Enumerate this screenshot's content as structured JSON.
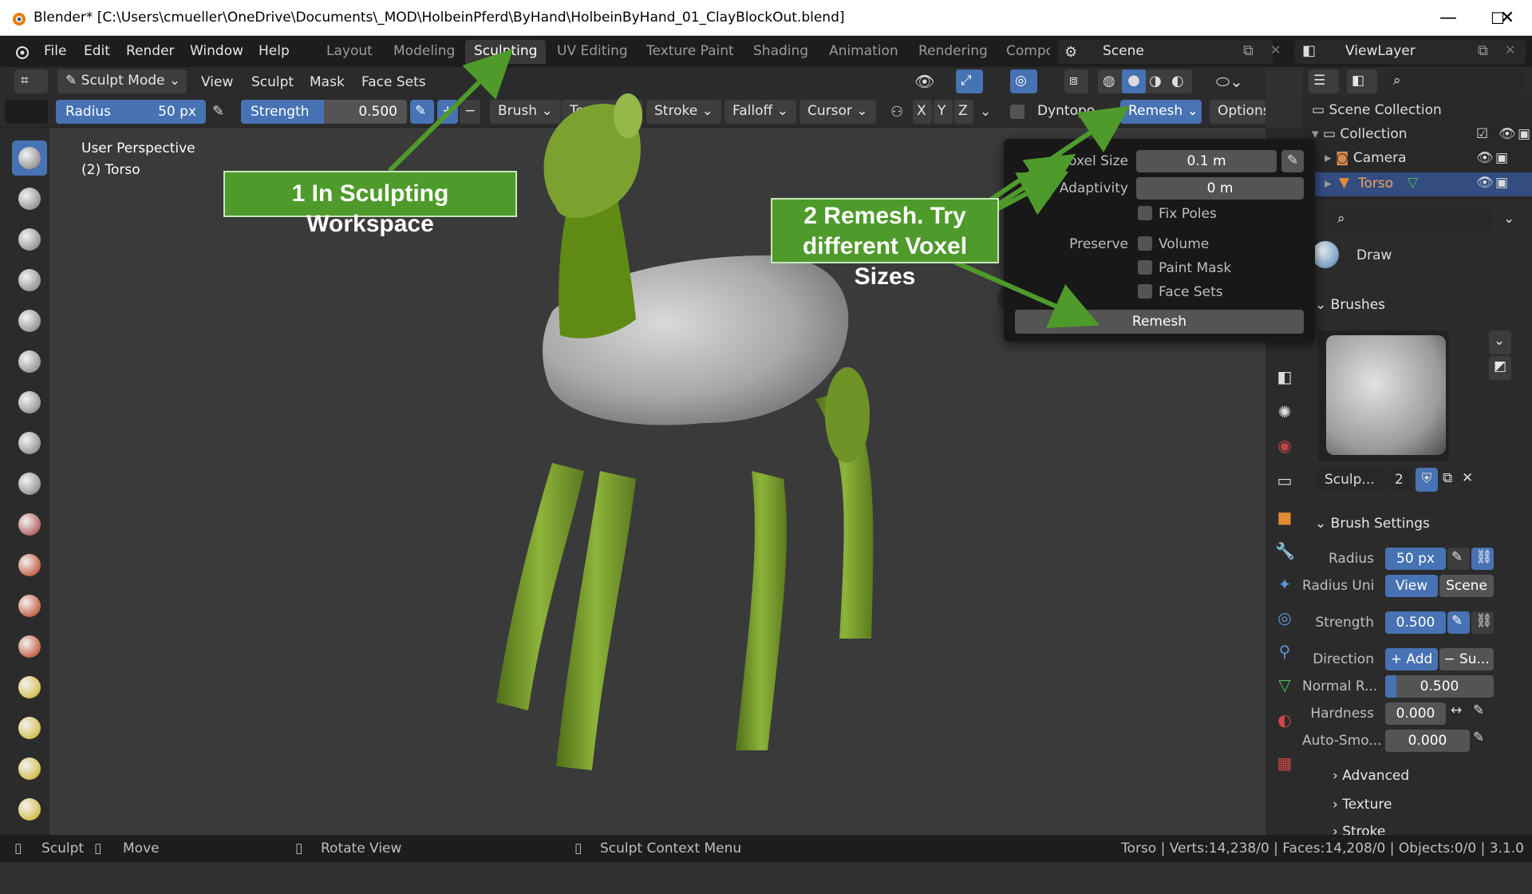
{
  "titlebar": {
    "title": "Blender* [C:\\Users\\cmueller\\OneDrive\\Documents\\_MOD\\HolbeinPferd\\ByHand\\HolbeinByHand_01_ClayBlockOut.blend]"
  },
  "menu": [
    "File",
    "Edit",
    "Render",
    "Window",
    "Help"
  ],
  "workspaces": [
    "Layout",
    "Modeling",
    "Sculpting",
    "UV Editing",
    "Texture Paint",
    "Shading",
    "Animation",
    "Rendering",
    "Compo"
  ],
  "scene": {
    "label": "Scene"
  },
  "viewlayer": {
    "label": "ViewLayer"
  },
  "header": {
    "mode": "Sculpt Mode",
    "menus": [
      "View",
      "Sculpt",
      "Mask",
      "Face Sets"
    ]
  },
  "tool": {
    "radius_label": "Radius",
    "radius_value": "50 px",
    "strength_label": "Strength",
    "strength_value": "0.500",
    "strength_fraction": 0.5,
    "menus": [
      "Brush",
      "Texture",
      "Stroke",
      "Falloff",
      "Cursor"
    ],
    "axes": [
      "X",
      "Y",
      "Z"
    ],
    "dyntopo": "Dyntopo",
    "remesh": "Remesh",
    "options": "Options"
  },
  "viewport": {
    "perspective": "User Perspective",
    "object": "(2) Torso"
  },
  "popup": {
    "voxel_size_label": "Voxel Size",
    "voxel_size_value": "0.1 m",
    "adaptivity_label": "Adaptivity",
    "adaptivity_value": "0 m",
    "fix_poles": "Fix Poles",
    "preserve_label": "Preserve",
    "volume": "Volume",
    "paint_mask": "Paint Mask",
    "face_sets": "Face Sets",
    "remesh_button": "Remesh"
  },
  "callouts": {
    "one": "1 In Sculpting Workspace",
    "two_line1": "2 Remesh. Try",
    "two_line2": "different Voxel Sizes"
  },
  "outliner": {
    "scene_collection": "Scene Collection",
    "collection": "Collection",
    "camera": "Camera",
    "torso": "Torso"
  },
  "properties": {
    "brush_name": "Draw",
    "brushes_section": "Brushes",
    "brush_slot_name": "Sculp...",
    "brush_users": "2",
    "brush_settings_section": "Brush Settings",
    "radius_label": "Radius",
    "radius_value": "50 px",
    "radius_unit_label": "Radius Uni",
    "radius_unit_view": "View",
    "radius_unit_scene": "Scene",
    "strength_label": "Strength",
    "strength_value": "0.500",
    "direction_label": "Direction",
    "direction_add": "+ Add",
    "direction_sub": "− Su...",
    "normal_label": "Normal R...",
    "normal_value": "0.500",
    "normal_fraction": 0.1,
    "hardness_label": "Hardness",
    "hardness_value": "0.000",
    "autosmooth_label": "Auto-Smo...",
    "autosmooth_value": "0.000",
    "advanced": "Advanced",
    "texture": "Texture",
    "stroke": "Stroke"
  },
  "statusbar": {
    "sculpt": "Sculpt",
    "move": "Move",
    "rotate": "Rotate View",
    "context": "Sculpt Context Menu",
    "stats": "Torso | Verts:14,238/0 | Faces:14,208/0 | Objects:0/0 | 3.1.0"
  },
  "colors": {
    "accent": "#4772b3",
    "callout": "#4e9a2b",
    "model_green": "#7ba12f",
    "model_grey": "#b4b4b4"
  }
}
